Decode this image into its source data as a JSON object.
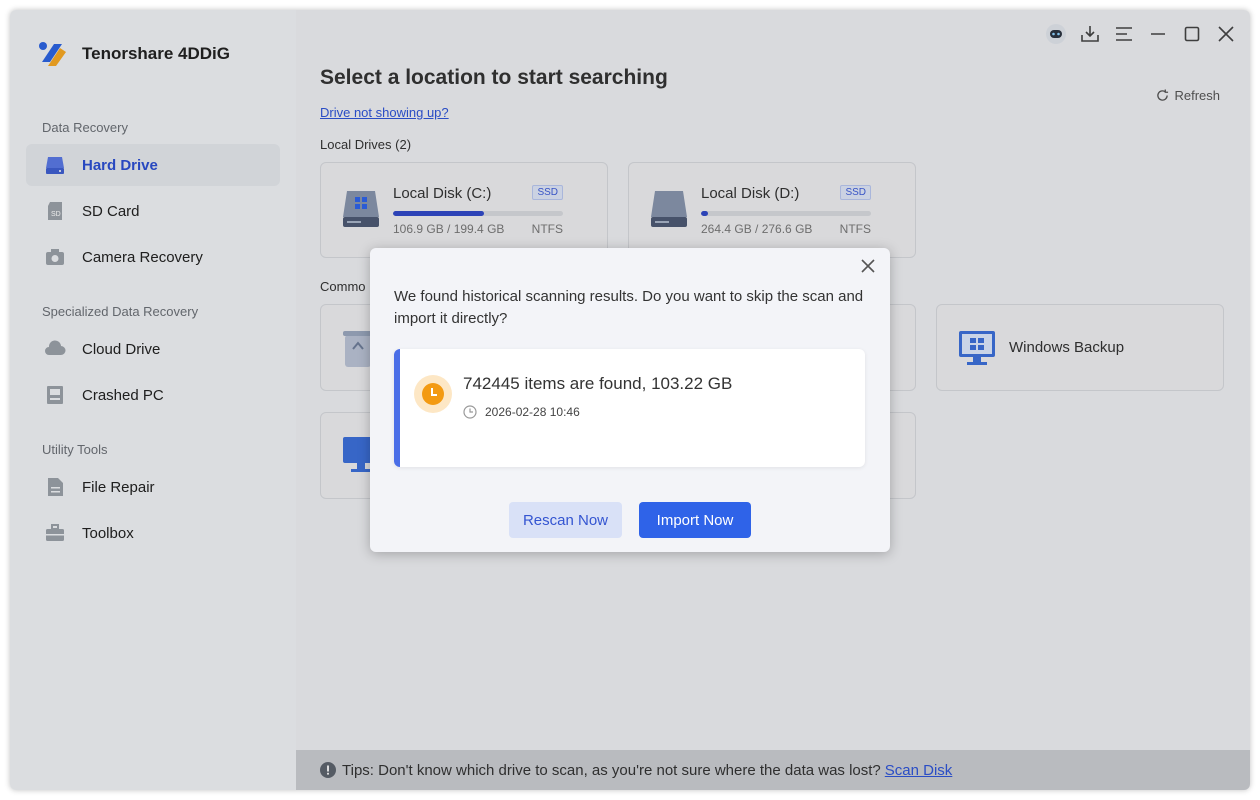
{
  "app": {
    "name": "Tenorshare 4DDiG"
  },
  "sidebar": {
    "sections": [
      {
        "title": "Data Recovery"
      },
      {
        "title": "Specialized Data Recovery"
      },
      {
        "title": "Utility Tools"
      }
    ],
    "items": [
      {
        "label": "Hard Drive",
        "icon": "hard-drive-icon",
        "active": true
      },
      {
        "label": "SD Card",
        "icon": "sd-card-icon"
      },
      {
        "label": "Camera Recovery",
        "icon": "camera-icon"
      },
      {
        "label": "Cloud Drive",
        "icon": "cloud-icon"
      },
      {
        "label": "Crashed PC",
        "icon": "crashed-pc-icon"
      },
      {
        "label": "File Repair",
        "icon": "file-icon"
      },
      {
        "label": "Toolbox",
        "icon": "toolbox-icon"
      }
    ]
  },
  "main": {
    "title": "Select a location to start searching",
    "drive_link": "Drive not showing up?",
    "refresh": "Refresh",
    "local_drives_label": "Local Drives (2)",
    "common_label": "Commo",
    "drives": [
      {
        "name": "Local Disk (C:)",
        "badge": "SSD",
        "size": "106.9 GB / 199.4 GB",
        "fs": "NTFS",
        "used_fraction": 0.536
      },
      {
        "name": "Local Disk (D:)",
        "badge": "SSD",
        "size": "264.4 GB / 276.6 GB",
        "fs": "NTFS",
        "used_fraction": 0.044
      }
    ],
    "common_locations": {
      "windows_backup": "Windows Backup"
    },
    "tips": {
      "text": "Tips: Don't know which drive to scan, as you're not sure where the data was lost?",
      "link": "Scan Disk"
    }
  },
  "dialog": {
    "message": "We found historical scanning results. Do you want to skip the scan and import it directly?",
    "result_title": "742445 items are found, 103.22 GB",
    "result_time": "2026-02-28 10:46",
    "rescan": "Rescan Now",
    "import": "Import Now"
  },
  "colors": {
    "accent": "#2f63e8",
    "active_nav": "#2c4fd1",
    "progress": "#3049c7",
    "clock": "#f39a12"
  }
}
